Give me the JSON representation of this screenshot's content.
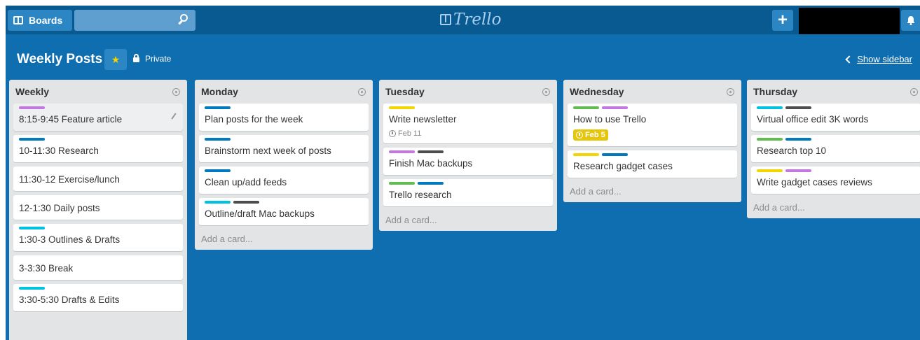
{
  "topbar": {
    "boards_label": "Boards",
    "search_value": "",
    "logo_text": "Trello",
    "add_label": "+"
  },
  "board": {
    "title": "Weekly Posts",
    "visibility": "Private",
    "show_sidebar": "Show sidebar"
  },
  "colors": {
    "background": "#0f6eb0",
    "topbar": "#0a5a92",
    "green": "#61bd4f",
    "yellow": "#f2d600",
    "purple": "#c377e0",
    "blue": "#0079bf",
    "sky": "#00c2e0",
    "black": "#4d4d4d"
  },
  "add_card_label": "Add a card...",
  "lists": [
    {
      "title": "Weekly",
      "cards": [
        {
          "text": "8:15-9:45 Feature article",
          "labels": [
            "purple"
          ]
        },
        {
          "text": "10-11:30 Research",
          "labels": [
            "blue"
          ]
        },
        {
          "text": "11:30-12 Exercise/lunch",
          "labels": []
        },
        {
          "text": "12-1:30 Daily posts",
          "labels": []
        },
        {
          "text": "1:30-3 Outlines & Drafts",
          "labels": [
            "sky"
          ]
        },
        {
          "text": "3-3:30 Break",
          "labels": []
        },
        {
          "text": "3:30-5:30 Drafts & Edits",
          "labels": [
            "sky"
          ]
        }
      ]
    },
    {
      "title": "Monday",
      "cards": [
        {
          "text": "Plan posts for the week",
          "labels": [
            "blue"
          ]
        },
        {
          "text": "Brainstorm next week of posts",
          "labels": [
            "blue"
          ]
        },
        {
          "text": "Clean up/add feeds",
          "labels": [
            "blue"
          ]
        },
        {
          "text": "Outline/draft Mac backups",
          "labels": [
            "sky",
            "black"
          ]
        }
      ]
    },
    {
      "title": "Tuesday",
      "cards": [
        {
          "text": "Write newsletter",
          "labels": [
            "yellow"
          ],
          "due": "Feb 11"
        },
        {
          "text": "Finish Mac backups",
          "labels": [
            "purple",
            "black"
          ]
        },
        {
          "text": "Trello research",
          "labels": [
            "green",
            "blue"
          ]
        }
      ]
    },
    {
      "title": "Wednesday",
      "cards": [
        {
          "text": "How to use Trello",
          "labels": [
            "green",
            "purple"
          ],
          "due": "Feb 5",
          "due_highlight": true
        },
        {
          "text": "Research gadget cases",
          "labels": [
            "yellow",
            "blue"
          ]
        }
      ]
    },
    {
      "title": "Thursday",
      "cards": [
        {
          "text": "Virtual office edit 3K words",
          "labels": [
            "sky",
            "black"
          ]
        },
        {
          "text": "Research top 10",
          "labels": [
            "green",
            "blue"
          ]
        },
        {
          "text": "Write gadget cases reviews",
          "labels": [
            "yellow",
            "purple"
          ]
        }
      ]
    }
  ]
}
